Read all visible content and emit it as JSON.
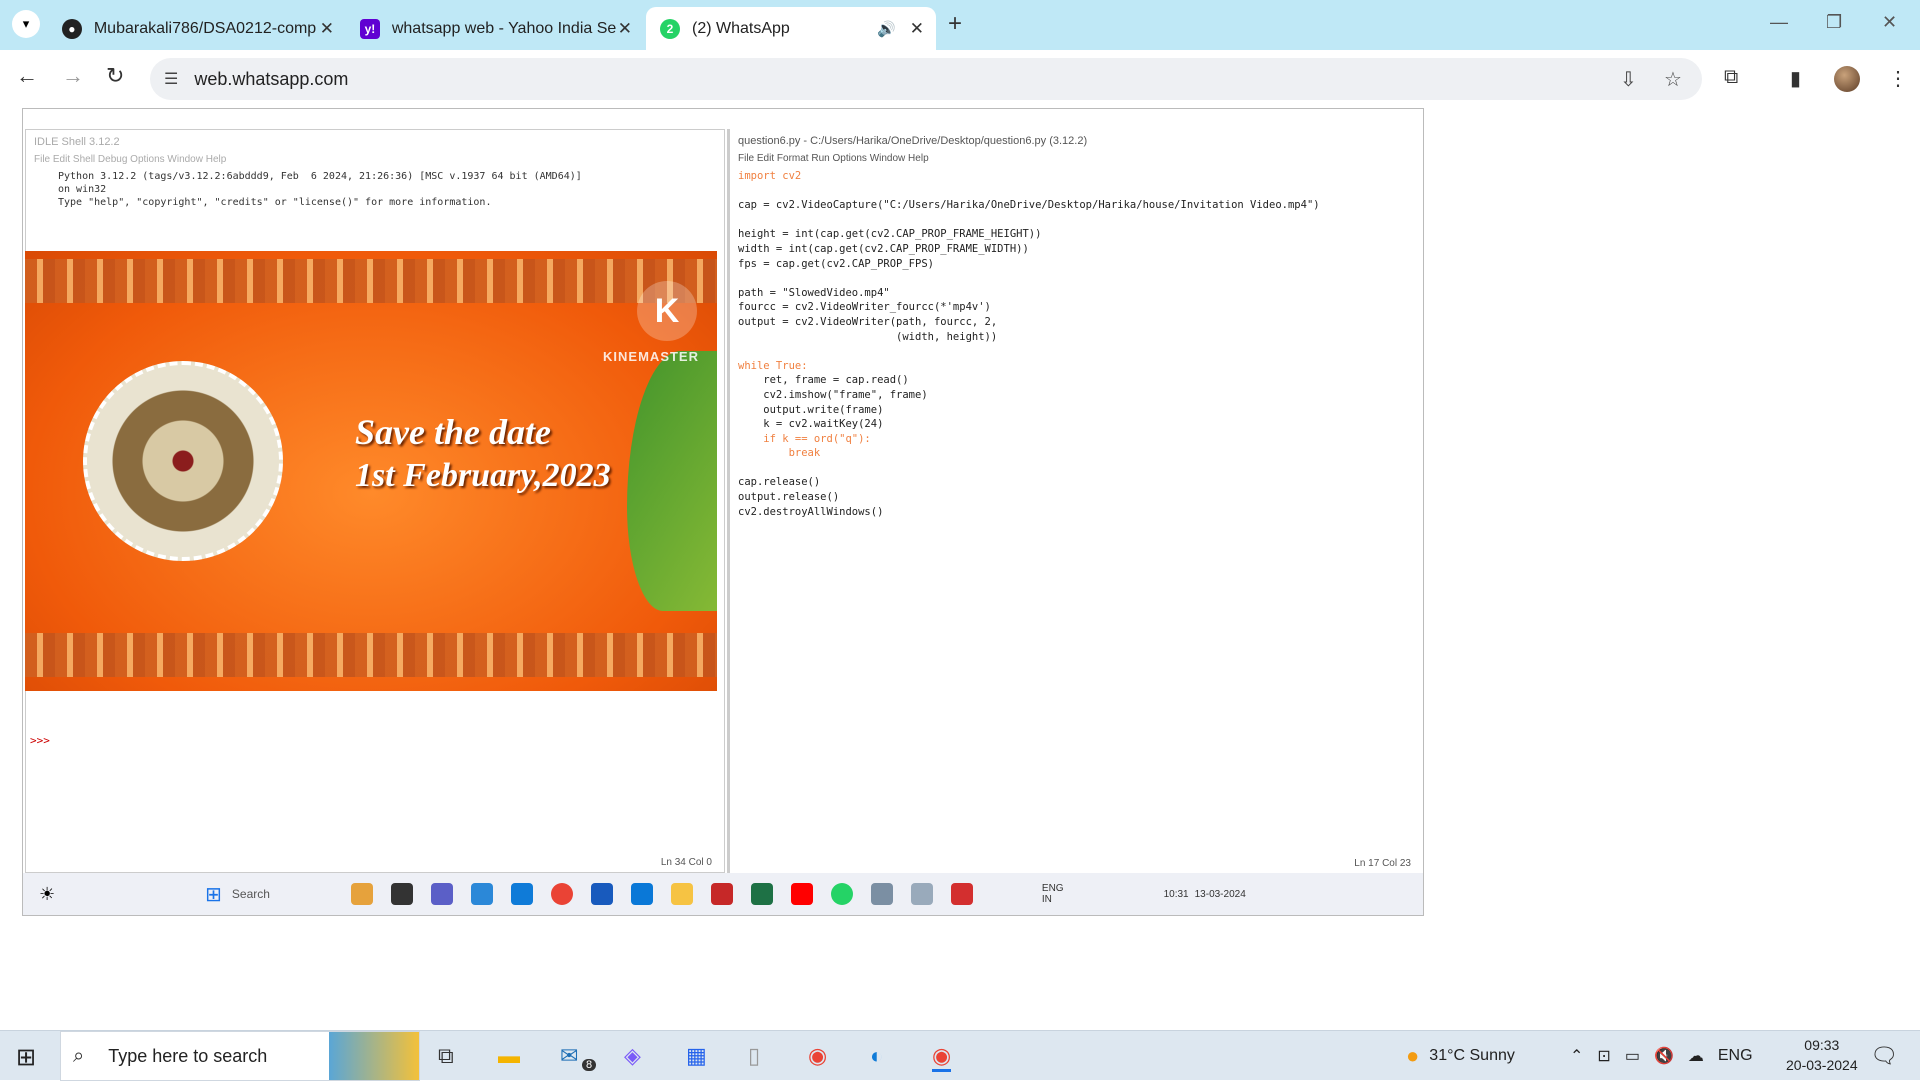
{
  "browser": {
    "tabs": [
      {
        "label": "Mubarakali786/DSA0212-comp",
        "icon": "github-icon",
        "active": false
      },
      {
        "label": "whatsapp web - Yahoo India Se",
        "icon": "yahoo-icon",
        "active": false
      },
      {
        "label": "(2) WhatsApp",
        "icon": "whatsapp-icon",
        "active": true
      }
    ],
    "url": "web.whatsapp.com"
  },
  "idle_shell": {
    "title": "IDLE Shell 3.12.2",
    "menu": "File   Edit   Shell   Debug   Options   Window   Help",
    "banner": "Python 3.12.2 (tags/v3.12.2:6abddd9, Feb  6 2024, 21:26:36) [MSC v.1937 64 bit (AMD64)]\non win32\nType \"help\", \"copyright\", \"credits\" or \"license()\" for more information.",
    "prompt": ">>>",
    "status": "Ln 34   Col 0"
  },
  "video": {
    "brand_letter": "K",
    "brand": "KINEMASTER",
    "line1": "Save the date",
    "line2": "1st February,2023"
  },
  "editor": {
    "title": "question6.py - C:/Users/Harika/OneDrive/Desktop/question6.py (3.12.2)",
    "menu": "File   Edit   Format   Run   Options   Window   Help",
    "status": "Ln 17   Col 23",
    "code": [
      "import cv2",
      "",
      "cap = cv2.VideoCapture(\"C:/Users/Harika/OneDrive/Desktop/Harika/house/Invitation Video.mp4\")",
      "",
      "height = int(cap.get(cv2.CAP_PROP_FRAME_HEIGHT))",
      "width = int(cap.get(cv2.CAP_PROP_FRAME_WIDTH))",
      "fps = cap.get(cv2.CAP_PROP_FPS)",
      "",
      "path = \"SlowedVideo.mp4\"",
      "fourcc = cv2.VideoWriter_fourcc(*'mp4v')",
      "output = cv2.VideoWriter(path, fourcc, 2,",
      "                         (width, height))",
      "",
      "while True:",
      "    ret, frame = cap.read()",
      "    cv2.imshow(\"frame\", frame)",
      "    output.write(frame)",
      "    k = cv2.waitKey(24)",
      "    if k == ord(\"q\"):",
      "        break",
      "",
      "cap.release()",
      "output.release()",
      "cv2.destroyAllWindows()"
    ]
  },
  "inner_taskbar": {
    "search": "Search",
    "lang": "ENG\nIN",
    "time": "10:31",
    "date": "13-03-2024"
  },
  "taskbar": {
    "search_placeholder": "Type here to search",
    "mail_badge": "8",
    "weather": "31°C  Sunny",
    "lang": "ENG",
    "time": "09:33",
    "date": "20-03-2024"
  }
}
